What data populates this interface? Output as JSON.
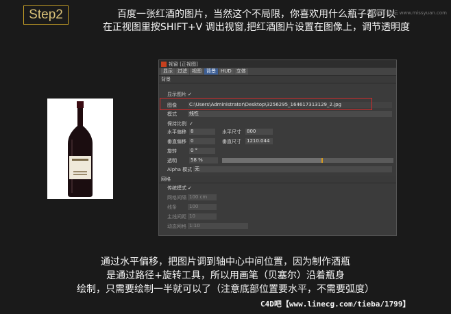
{
  "step_label": "Step2",
  "header_line1": "百度一张红酒的图片，当然这个不局限，你喜欢用什么瓶子都可以",
  "header_line2": "在正视图里按SHIFT+V 调出视窗,把红酒图片设置在图像上，调节透明度",
  "watermark": "思缘设计论坛 www.missyuan.com",
  "bottle_label": "CHATEAU LAGRANGE",
  "viewport": {
    "title": "视窗 [正视图]",
    "tabs": [
      "显示",
      "过滤",
      "视图",
      "背景",
      "HUD",
      "立体"
    ],
    "active_tab": "背景",
    "section_back": "背景",
    "show_image_label": "显示图片",
    "show_image_check": "✓",
    "image_label": "图像",
    "image_path": "C:\\Users\\Administrator\\Desktop\\3256295_164617313129_2.jpg",
    "mode_label": "模式",
    "mode_value": "线性",
    "keep_ratio_label": "保持比例",
    "keep_ratio_check": "✓",
    "h_offset_label": "水平偏移",
    "h_offset_value": "8",
    "h_size_label": "水平尺寸",
    "h_size_value": "800",
    "v_offset_label": "垂直偏移",
    "v_offset_value": "0",
    "v_size_label": "垂直尺寸",
    "v_size_value": "1210.044",
    "rotate_label": "旋转",
    "rotate_value": "0 °",
    "opacity_label": "透明",
    "opacity_value": "58 %",
    "opacity_fraction": 0.58,
    "alpha_label": "Alpha 模式",
    "alpha_value": "无",
    "section_grid": "网格",
    "grid_mode_label": "传统模式",
    "grid_mode_check": "✓",
    "grid_spacing_label": "网格间隔",
    "grid_spacing_value": "100 cm",
    "lines_label": "线条",
    "lines_value": "100",
    "main_lines_label": "主线间距",
    "main_lines_value": "10",
    "dynamic_label": "动态网格",
    "dynamic_value": "1:10"
  },
  "caption_line1": "通过水平偏移，把图片调到轴中心中间位置，因为制作酒瓶",
  "caption_line2": "是通过路径+旋转工具，所以用画笔（贝塞尔）沿着瓶身",
  "caption_line3": "绘制，只需要绘制一半就可以了（注意底部位置要水平，不需要弧度）",
  "credit": "C4D吧【www.linecg.com/tieba/1799】"
}
